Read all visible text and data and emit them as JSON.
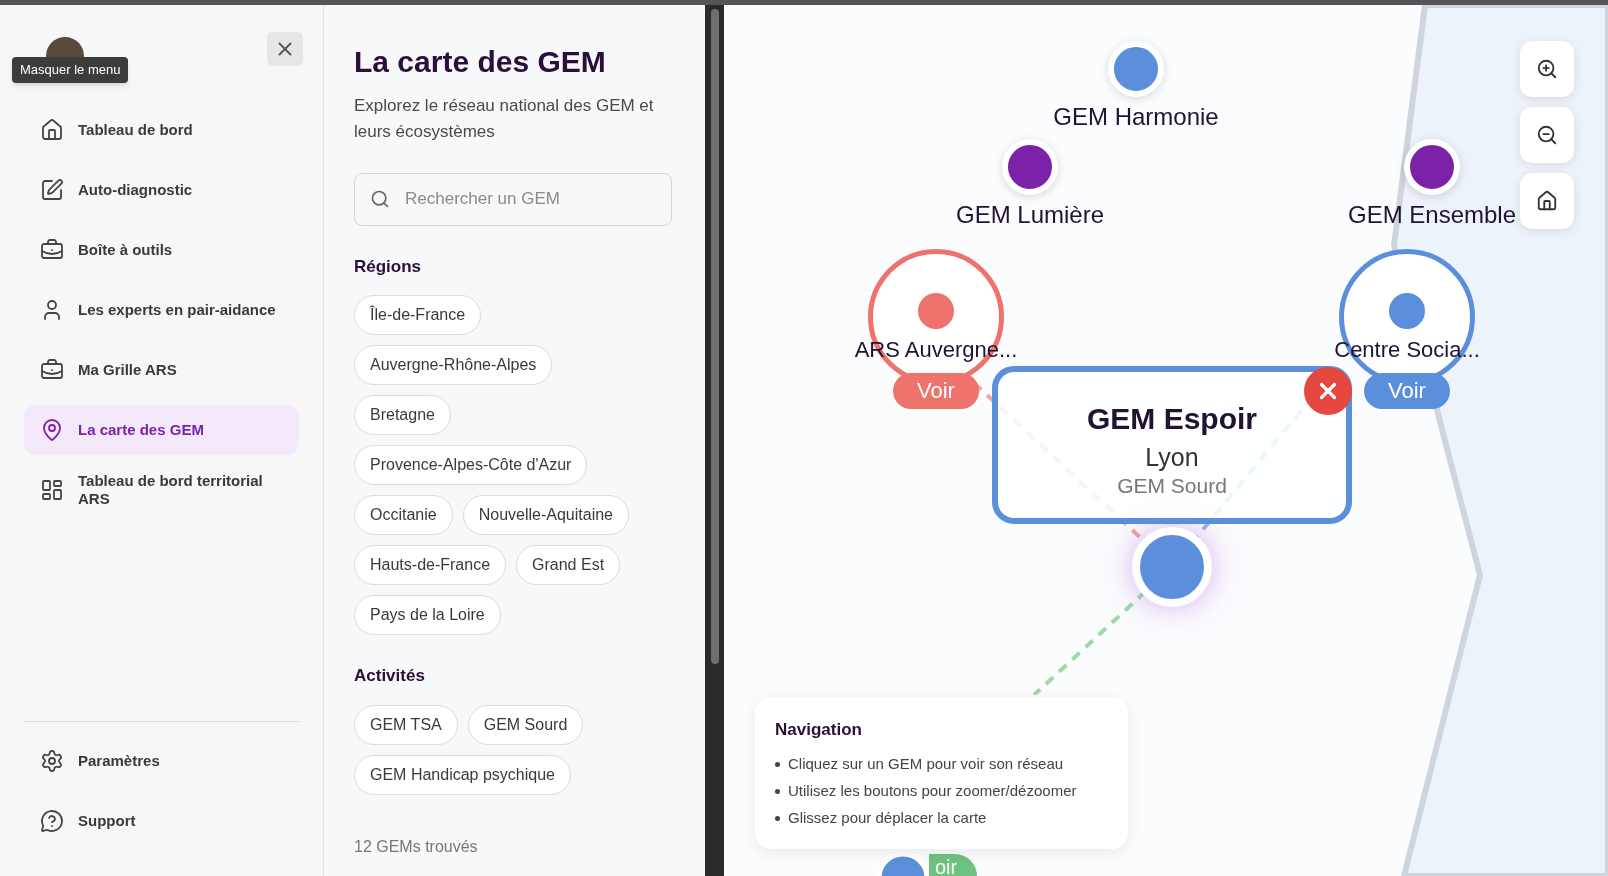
{
  "sidebar": {
    "tooltip": "Masquer le menu",
    "nav_items": [
      {
        "label": "Tableau de bord",
        "selected": false
      },
      {
        "label": "Auto-diagnostic",
        "selected": false
      },
      {
        "label": "Boîte à outils",
        "selected": false
      },
      {
        "label": "Les experts en pair-aidance",
        "selected": false
      },
      {
        "label": "Ma Grille ARS",
        "selected": false
      },
      {
        "label": "La carte des GEM",
        "selected": true
      },
      {
        "label": "Tableau de bord territorial ARS",
        "selected": false
      }
    ],
    "footer_items": [
      {
        "label": "Paramètres"
      },
      {
        "label": "Support"
      }
    ]
  },
  "panel": {
    "title": "La carte des GEM",
    "subtitle": "Explorez le réseau national des GEM et leurs écosystèmes",
    "search": {
      "placeholder": "Rechercher un GEM"
    },
    "sections": [
      {
        "title": "Régions",
        "chips": [
          "Île-de-France",
          "Auvergne-Rhône-Alpes",
          "Bretagne",
          "Provence-Alpes-Côte d'Azur",
          "Occitanie",
          "Nouvelle-Aquitaine",
          "Hauts-de-France",
          "Grand Est",
          "Pays de la Loire"
        ]
      },
      {
        "title": "Activités",
        "chips": [
          "GEM TSA",
          "GEM Sourd",
          "GEM Handicap psychique"
        ]
      }
    ],
    "count": "12 GEMs trouvés"
  },
  "map": {
    "nodes": [
      {
        "kind": "gem",
        "label": "GEM Harmonie",
        "color": "#5b8fdc"
      },
      {
        "kind": "gem",
        "label": "GEM Lumière",
        "color": "#7b22a8"
      },
      {
        "kind": "gem",
        "label": "GEM Ensemble",
        "color": "#7b22a8"
      },
      {
        "kind": "partner",
        "label": "ARS Auvergne...",
        "button": "Voir",
        "color": "#ee736c"
      },
      {
        "kind": "partner",
        "label": "Centre Socia...",
        "button": "Voir",
        "color": "#5b8fdc"
      },
      {
        "kind": "selected",
        "color": "#5b8fdc"
      },
      {
        "kind": "partial",
        "button": "oir",
        "color": "#5b8fdc"
      }
    ],
    "popup": {
      "title": "GEM Espoir",
      "city": "Lyon",
      "activity": "GEM Sourd"
    },
    "help": {
      "title": "Navigation",
      "items": [
        "Cliquez sur un GEM pour voir son réseau",
        "Utilisez les boutons pour zoomer/dézoomer",
        "Glissez pour déplacer la carte"
      ]
    }
  }
}
